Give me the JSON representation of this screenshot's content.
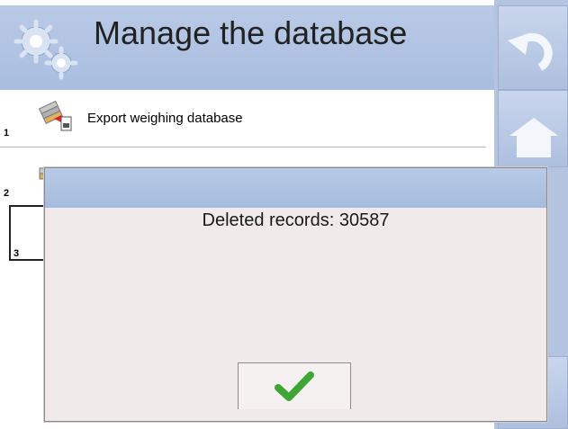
{
  "header": {
    "title": "Manage the database",
    "icon": "gears-icon"
  },
  "nav": {
    "undo_icon": "undo-icon",
    "home_icon": "home-icon"
  },
  "list": {
    "items": [
      {
        "number": "1",
        "label": "Export weighing database",
        "icon": "export-database-icon"
      },
      {
        "number": "2",
        "icon": "database-icon"
      },
      {
        "number": "3",
        "icon": "database-icon"
      }
    ]
  },
  "dialog": {
    "message": "Deleted records: 30587",
    "confirm_icon": "checkmark-icon",
    "confirm_color": "#3fa535"
  }
}
